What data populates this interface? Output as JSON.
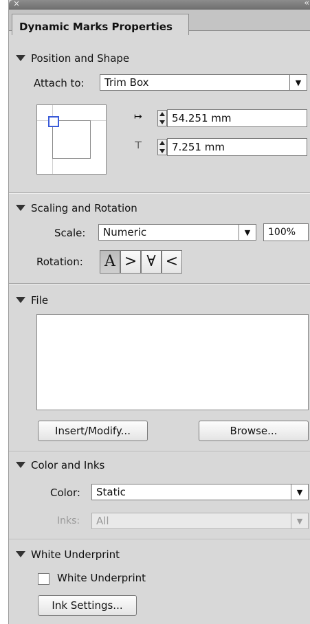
{
  "titlebar": {
    "close_glyph": "×",
    "collapse_glyph": "‹‹"
  },
  "tab": {
    "label": "Dynamic Marks Properties"
  },
  "position": {
    "heading": "Position and Shape",
    "attach_label": "Attach to:",
    "attach_value": "Trim Box",
    "horizontal_value": "54.251 mm",
    "vertical_value": "7.251 mm",
    "horizontal_icon": "↦",
    "vertical_icon": "⊤"
  },
  "scaling": {
    "heading": "Scaling and Rotation",
    "scale_label": "Scale:",
    "scale_value": "Numeric",
    "scale_percent": "100%",
    "rotation_label": "Rotation:",
    "rotations": [
      "A",
      ">",
      "∀",
      "<"
    ]
  },
  "file": {
    "heading": "File",
    "insert_label": "Insert/Modify...",
    "browse_label": "Browse..."
  },
  "color": {
    "heading": "Color and Inks",
    "color_label": "Color:",
    "color_value": "Static",
    "inks_label": "Inks:",
    "inks_value": "All"
  },
  "underprint": {
    "heading": "White Underprint",
    "checkbox_label": "White Underprint",
    "checked": false,
    "ink_settings_label": "Ink Settings..."
  },
  "colors": {
    "accent_square": "#3a5bd9",
    "panel_bg": "#d8d8d8"
  }
}
